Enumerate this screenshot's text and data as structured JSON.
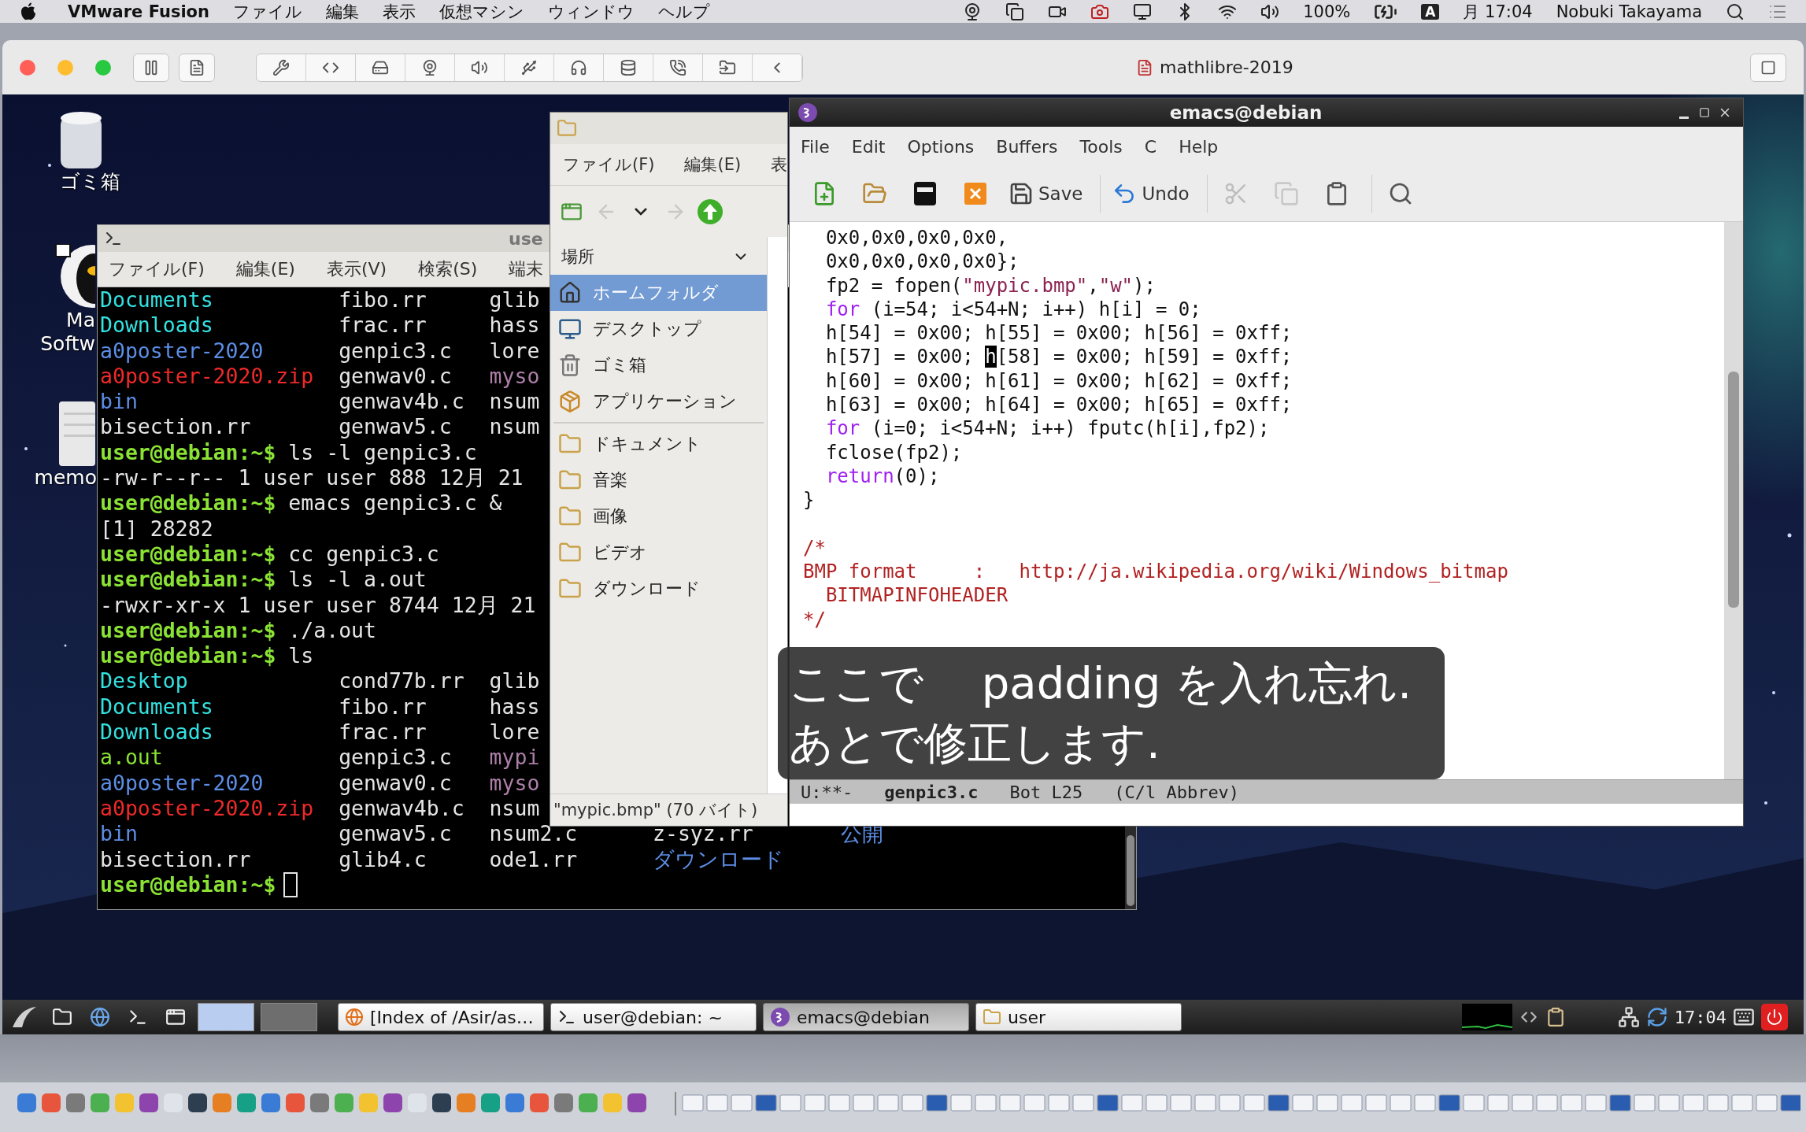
{
  "mac_menubar": {
    "app": "VMware Fusion",
    "menus": [
      "ファイル",
      "編集",
      "表示",
      "仮想マシン",
      "ウィンドウ",
      "ヘルプ"
    ],
    "battery": "100%",
    "input_source": "A",
    "clock": "月 17:04",
    "user": "Nobuki Takayama"
  },
  "vmware_window": {
    "title": "mathlibre-2019"
  },
  "desktop_icons": [
    {
      "kind": "trash",
      "label": [
        "ゴミ箱"
      ]
    },
    {
      "kind": "app",
      "label": [
        "Ma",
        "Softw"
      ]
    },
    {
      "kind": "document",
      "label": [
        "memo"
      ]
    }
  ],
  "terminal": {
    "title": "use",
    "menus": [
      "ファイル(F)",
      "編集(E)",
      "表示(V)",
      "検索(S)",
      "端末"
    ],
    "lines": [
      {
        "kind": "listing",
        "cells": [
          {
            "text": "Documents",
            "color": "#34e2e2"
          },
          {
            "text": "fibo.rr",
            "color": "#e5e5e5"
          },
          {
            "text": "glib",
            "color": "#e5e5e5"
          }
        ]
      },
      {
        "kind": "listing",
        "cells": [
          {
            "text": "Downloads",
            "color": "#34e2e2"
          },
          {
            "text": "frac.rr",
            "color": "#e5e5e5"
          },
          {
            "text": "hass",
            "color": "#e5e5e5"
          }
        ]
      },
      {
        "kind": "listing",
        "cells": [
          {
            "text": "a0poster-2020",
            "color": "#5c8ee6"
          },
          {
            "text": "genpic3.c",
            "color": "#e5e5e5"
          },
          {
            "text": "lore",
            "color": "#e5e5e5"
          }
        ]
      },
      {
        "kind": "listing",
        "cells": [
          {
            "text": "a0poster-2020.zip",
            "color": "#ef2929"
          },
          {
            "text": "genwav0.c",
            "color": "#e5e5e5"
          },
          {
            "text": "myso",
            "color": "#ad7fa8"
          }
        ]
      },
      {
        "kind": "listing",
        "cells": [
          {
            "text": "bin",
            "color": "#5c8ee6"
          },
          {
            "text": "genwav4b.c",
            "color": "#e5e5e5"
          },
          {
            "text": "nsum",
            "color": "#e5e5e5"
          }
        ]
      },
      {
        "kind": "listing",
        "cells": [
          {
            "text": "bisection.rr",
            "color": "#e5e5e5"
          },
          {
            "text": "genwav5.c",
            "color": "#e5e5e5"
          },
          {
            "text": "nsum",
            "color": "#e5e5e5"
          }
        ]
      },
      {
        "kind": "command",
        "prompt": "user@debian:~$",
        "command": "ls -l genpic3.c"
      },
      {
        "kind": "output",
        "text": "-rw-r--r-- 1 user user 888 12月 21"
      },
      {
        "kind": "command",
        "prompt": "user@debian:~$",
        "command": "emacs genpic3.c &"
      },
      {
        "kind": "output",
        "text": "[1] 28282"
      },
      {
        "kind": "command",
        "prompt": "user@debian:~$",
        "command": "cc genpic3.c"
      },
      {
        "kind": "command",
        "prompt": "user@debian:~$",
        "command": "ls -l a.out"
      },
      {
        "kind": "output",
        "text": "-rwxr-xr-x 1 user user 8744 12月 21"
      },
      {
        "kind": "command",
        "prompt": "user@debian:~$",
        "command": "./a.out"
      },
      {
        "kind": "command",
        "prompt": "user@debian:~$",
        "command": "ls"
      },
      {
        "kind": "listing",
        "cells": [
          {
            "text": "Desktop",
            "color": "#34e2e2"
          },
          {
            "text": "cond77b.rr",
            "color": "#e5e5e5"
          },
          {
            "text": "glib",
            "color": "#e5e5e5"
          }
        ]
      },
      {
        "kind": "listing",
        "cells": [
          {
            "text": "Documents",
            "color": "#34e2e2"
          },
          {
            "text": "fibo.rr",
            "color": "#e5e5e5"
          },
          {
            "text": "hass",
            "color": "#e5e5e5"
          }
        ]
      },
      {
        "kind": "listing",
        "cells": [
          {
            "text": "Downloads",
            "color": "#34e2e2"
          },
          {
            "text": "frac.rr",
            "color": "#e5e5e5"
          },
          {
            "text": "lore",
            "color": "#e5e5e5"
          }
        ]
      },
      {
        "kind": "listing",
        "cells": [
          {
            "text": "a.out",
            "color": "#8ae234"
          },
          {
            "text": "genpic3.c",
            "color": "#e5e5e5"
          },
          {
            "text": "mypi",
            "color": "#ad7fa8"
          }
        ]
      },
      {
        "kind": "listing",
        "cells": [
          {
            "text": "a0poster-2020",
            "color": "#5c8ee6"
          },
          {
            "text": "genwav0.c",
            "color": "#e5e5e5"
          },
          {
            "text": "myso",
            "color": "#ad7fa8"
          }
        ]
      },
      {
        "kind": "listing",
        "cells": [
          {
            "text": "a0poster-2020.zip",
            "color": "#ef2929"
          },
          {
            "text": "genwav4b.c",
            "color": "#e5e5e5"
          },
          {
            "text": "nsum",
            "color": "#e5e5e5"
          }
        ]
      },
      {
        "kind": "listing",
        "cells": [
          {
            "text": "bin",
            "color": "#5c8ee6"
          },
          {
            "text": "genwav5.c",
            "color": "#e5e5e5"
          },
          {
            "text": "nsum2.c",
            "color": "#e5e5e5"
          },
          {
            "text": "z-syz.rr",
            "color": "#e5e5e5"
          },
          {
            "text": "公開",
            "color": "#5c8ee6"
          }
        ]
      },
      {
        "kind": "listing",
        "cells": [
          {
            "text": "bisection.rr",
            "color": "#e5e5e5"
          },
          {
            "text": "glib4.c",
            "color": "#e5e5e5"
          },
          {
            "text": "ode1.rr",
            "color": "#e5e5e5"
          },
          {
            "text": "ダウンロード",
            "color": "#5c8ee6"
          }
        ]
      },
      {
        "kind": "command",
        "prompt": "user@debian:~$",
        "cursor": true
      }
    ]
  },
  "file_manager": {
    "menus": [
      "ファイル(F)",
      "編集(E)",
      "表"
    ],
    "toolbar": [
      {
        "kind": "new-window",
        "disabled": false
      },
      {
        "kind": "back",
        "disabled": true
      },
      {
        "kind": "history",
        "disabled": false
      },
      {
        "kind": "forward",
        "disabled": true
      },
      {
        "kind": "up",
        "disabled": false
      }
    ],
    "places_header": "場所",
    "places": [
      {
        "kind": "home",
        "label": "ホームフォルダ",
        "selected": true
      },
      {
        "kind": "desktop",
        "label": "デスクトップ",
        "selected": false
      },
      {
        "kind": "trash",
        "label": "ゴミ箱",
        "selected": false
      },
      {
        "kind": "apps",
        "label": "アプリケーション",
        "selected": false
      }
    ],
    "bookmarks": [
      {
        "label": "ドキュメント",
        "selected": false
      },
      {
        "label": "音楽",
        "selected": false
      },
      {
        "label": "画像",
        "selected": false
      },
      {
        "label": "ビデオ",
        "selected": false
      },
      {
        "label": "ダウンロード",
        "selected": false
      }
    ],
    "status": "\"mypic.bmp\" (70 バイト)"
  },
  "emacs": {
    "title": "emacs@debian",
    "menus": [
      "File",
      "Edit",
      "Options",
      "Buffers",
      "Tools",
      "C",
      "Help"
    ],
    "toolbar": [
      {
        "kind": "new",
        "disabled": false
      },
      {
        "kind": "open",
        "disabled": false
      },
      {
        "kind": "disk",
        "disabled": false
      },
      {
        "kind": "close",
        "disabled": false
      },
      {
        "kind": "save",
        "label": "Save",
        "disabled": false
      },
      {
        "kind": "undo",
        "label": "Undo",
        "disabled": false
      },
      {
        "kind": "cut",
        "disabled": true
      },
      {
        "kind": "copy",
        "disabled": true
      },
      {
        "kind": "paste",
        "disabled": false
      },
      {
        "kind": "search",
        "disabled": false
      }
    ],
    "code": [
      {
        "kind": "code",
        "segments": [
          {
            "kind": "plain",
            "text": "  0x0,0x0,0x0,0x0,"
          }
        ]
      },
      {
        "kind": "code",
        "segments": [
          {
            "kind": "plain",
            "text": "  0x0,0x0,0x0,0x0};"
          }
        ]
      },
      {
        "kind": "code",
        "segments": [
          {
            "kind": "plain",
            "text": "  fp2 = fopen("
          },
          {
            "kind": "string",
            "text": "\"mypic.bmp\""
          },
          {
            "kind": "plain",
            "text": ","
          },
          {
            "kind": "string",
            "text": "\"w\""
          },
          {
            "kind": "plain",
            "text": ");"
          }
        ]
      },
      {
        "kind": "code",
        "segments": [
          {
            "kind": "keyword",
            "text": "  for"
          },
          {
            "kind": "plain",
            "text": " (i=54; i<54+N; i++) h[i] = 0;"
          }
        ]
      },
      {
        "kind": "code",
        "segments": [
          {
            "kind": "plain",
            "text": "  h[54] = 0x00; h[55] = 0x00; h[56] = 0xff;"
          }
        ]
      },
      {
        "kind": "code",
        "segments": [
          {
            "kind": "plain",
            "text": "  h[57] = 0x00; "
          },
          {
            "kind": "cursor",
            "text": "h"
          },
          {
            "kind": "plain",
            "text": "[58] = 0x00; h[59] = 0xff;"
          }
        ]
      },
      {
        "kind": "code",
        "segments": [
          {
            "kind": "plain",
            "text": "  h[60] = 0x00; h[61] = 0x00; h[62] = 0xff;"
          }
        ]
      },
      {
        "kind": "code",
        "segments": [
          {
            "kind": "plain",
            "text": "  h[63] = 0x00; h[64] = 0x00; h[65] = 0xff;"
          }
        ]
      },
      {
        "kind": "code",
        "segments": [
          {
            "kind": "keyword",
            "text": "  for"
          },
          {
            "kind": "plain",
            "text": " (i=0; i<54+N; i++) fputc(h[i],fp2);"
          }
        ]
      },
      {
        "kind": "code",
        "segments": [
          {
            "kind": "plain",
            "text": "  fclose(fp2);"
          }
        ]
      },
      {
        "kind": "code",
        "segments": [
          {
            "kind": "keyword",
            "text": "  return"
          },
          {
            "kind": "plain",
            "text": "(0);"
          }
        ]
      },
      {
        "kind": "code",
        "segments": [
          {
            "kind": "plain",
            "text": "}"
          }
        ]
      },
      {
        "kind": "blank"
      },
      {
        "kind": "code",
        "segments": [
          {
            "kind": "comment",
            "text": "/*"
          }
        ]
      },
      {
        "kind": "code",
        "segments": [
          {
            "kind": "comment",
            "text": "BMP format     :   http://ja.wikipedia.org/wiki/Windows_bitmap"
          }
        ]
      },
      {
        "kind": "code",
        "segments": [
          {
            "kind": "comment",
            "text": "  BITMAPINFOHEADER"
          }
        ]
      },
      {
        "kind": "code",
        "segments": [
          {
            "kind": "comment",
            "text": "*/"
          }
        ]
      }
    ],
    "mode_line": {
      "status": "U:**-",
      "buffer": "genpic3.c",
      "position": "Bot L25",
      "modes": "(C/l Abbrev)"
    }
  },
  "subtitle": [
    "ここで　 padding を入れ忘れ.",
    "あとで修正します."
  ],
  "taskbar": {
    "desktops": [
      {
        "selected": true
      },
      {
        "selected": false
      }
    ],
    "tasks": [
      {
        "kind": "browser",
        "label": "[Index of /Asir/as…",
        "selected": false
      },
      {
        "kind": "terminal",
        "label": "user@debian: ~",
        "selected": false
      },
      {
        "kind": "emacs",
        "label": "emacs@debian",
        "selected": true
      },
      {
        "kind": "folder",
        "label": "user",
        "selected": false
      }
    ],
    "clock": "17:04"
  }
}
